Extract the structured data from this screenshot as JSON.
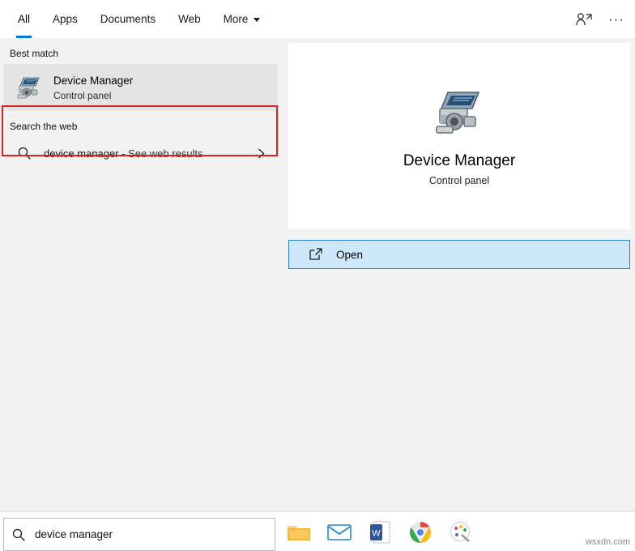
{
  "tabs": [
    {
      "label": "All",
      "active": true,
      "caret": false
    },
    {
      "label": "Apps",
      "active": false,
      "caret": false
    },
    {
      "label": "Documents",
      "active": false,
      "caret": false
    },
    {
      "label": "Web",
      "active": false,
      "caret": false
    },
    {
      "label": "More",
      "active": false,
      "caret": true
    }
  ],
  "topbar": {
    "share_icon": "person-share-icon",
    "more_icon": "ellipsis-icon",
    "more_label": "···"
  },
  "left": {
    "best_match_label": "Best match",
    "best_match": {
      "icon": "device-manager-icon",
      "title": "Device Manager",
      "subtitle": "Control panel"
    },
    "search_web_label": "Search the web",
    "web_result": {
      "icon": "search-icon",
      "query": "device manager",
      "suffix": " - See web results",
      "chevron": "›"
    },
    "highlight_color": "#e02020"
  },
  "right": {
    "icon": "device-manager-icon",
    "title": "Device Manager",
    "subtitle": "Control panel",
    "open": {
      "icon": "open-external-icon",
      "label": "Open"
    },
    "accent_color": "#2a7fd4",
    "open_bg": "#cde8fa"
  },
  "taskbar": {
    "search": {
      "icon": "magnifier-icon",
      "value": "device manager",
      "placeholder": "Type here to search"
    },
    "pinned": [
      {
        "name": "file-explorer-icon"
      },
      {
        "name": "mail-icon"
      },
      {
        "name": "word-icon",
        "letter": "W"
      },
      {
        "name": "chrome-icon"
      },
      {
        "name": "paint-icon"
      }
    ]
  },
  "watermark": "wsxdn.com"
}
